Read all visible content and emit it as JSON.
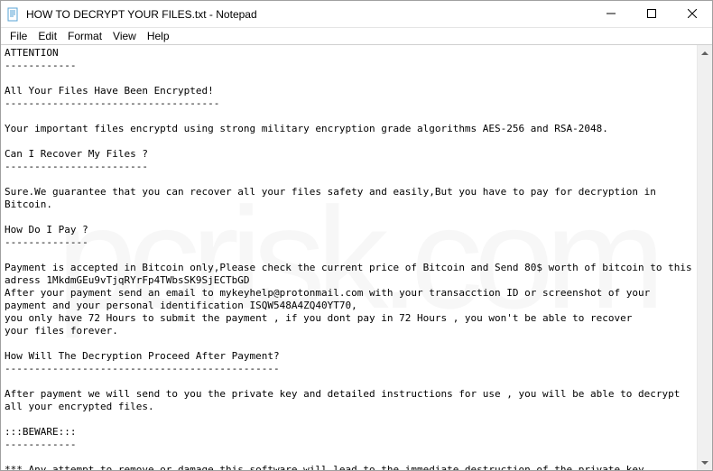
{
  "window": {
    "title": "HOW TO DECRYPT YOUR FILES.txt - Notepad",
    "app_icon": "notepad-icon"
  },
  "menubar": {
    "items": [
      "File",
      "Edit",
      "Format",
      "View",
      "Help"
    ]
  },
  "document": {
    "text": "ATTENTION\n------------\n\nAll Your Files Have Been Encrypted!\n------------------------------------\n\nYour important files encryptd using strong military encryption grade algorithms AES-256 and RSA-2048.\n\nCan I Recover My Files ?\n------------------------\n\nSure.We guarantee that you can recover all your files safety and easily,But you have to pay for decryption in Bitcoin.\n\nHow Do I Pay ?\n--------------\n\nPayment is accepted in Bitcoin only,Please check the current price of Bitcoin and Send 80$ worth of bitcoin to this adress 1MkdmGEu9vTjqRYrFp4TWbsSK9SjECTbGD\nAfter your payment send an email to mykeyhelp@protonmail.com with your transacction ID or screenshot of your payment and your personal identification ISQW548A4ZQ40YT70,\nyou only have 72 Hours to submit the payment , if you dont pay in 72 Hours , you won't be able to recover\nyour files forever.\n\nHow Will The Decryption Proceed After Payment?\n----------------------------------------------\n\nAfter payment we will send to you the private key and detailed instructions for use , you will be able to decrypt all your encrypted files.\n\n:::BEWARE:::\n------------\n\n*** Any attempt to remove or damage this software will lead to the immediate destruction of the private key.\n*** Do not rename encrypted files , Don't try to change encrypted files by youself ! , any changes in encryped files entail damage of the private key and the result\nthe loss all data .\n*** Do not try to decrypt your data using third party , it may cause permanent data loss."
  },
  "watermark": "pcrisk.com"
}
